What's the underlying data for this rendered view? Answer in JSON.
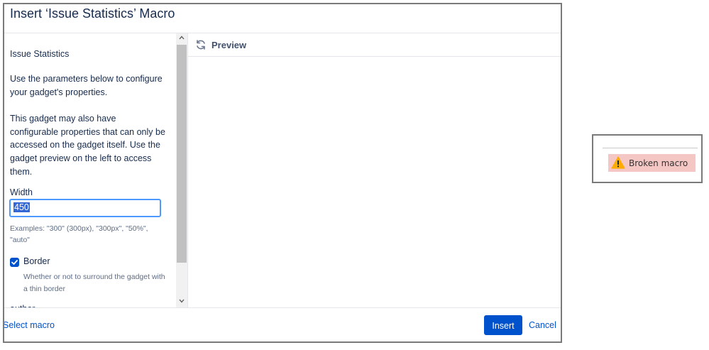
{
  "dialog": {
    "title": "Insert ‘Issue Statistics’ Macro"
  },
  "left_panel": {
    "heading": "Issue Statistics",
    "intro": "Use the parameters below to configure your gadget's properties.",
    "note": "This gadget may also have configurable properties that can only be accessed on the gadget itself. Use the gadget preview on the left to access them.",
    "width_label": "Width",
    "width_value": "450",
    "width_help": "Examples: \"300\" (300px), \"300px\", \"50%\", \"auto\"",
    "border_checked": true,
    "border_label": "Border",
    "border_help": "Whether or not to surround the gadget with a thin border",
    "next_field_label": "author"
  },
  "preview": {
    "label": "Preview",
    "icon": "refresh-icon"
  },
  "footer": {
    "select_macro": "Select macro",
    "insert": "Insert",
    "cancel": "Cancel"
  },
  "broken_macro": {
    "label": "Broken macro",
    "icon": "warning-icon"
  },
  "colors": {
    "primary": "#0052cc",
    "focus_ring": "#4c9aff",
    "broken_bg": "#f4c6c4",
    "warning": "#ffab00"
  }
}
